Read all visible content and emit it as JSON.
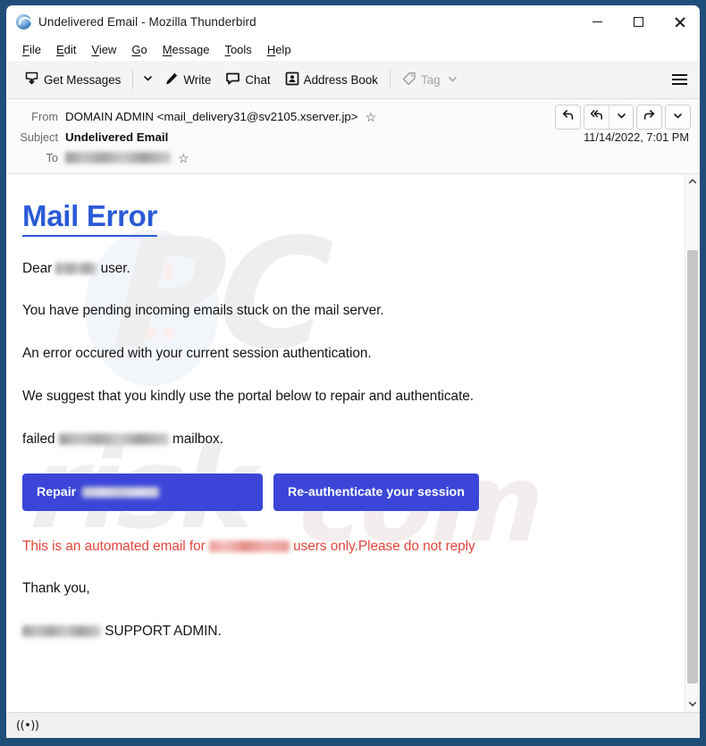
{
  "window": {
    "title": "Undelivered Email - Mozilla Thunderbird",
    "app_icon": "thunderbird-icon",
    "border_color": "#1f4e79",
    "controls": {
      "minimize": "minimize-icon",
      "maximize": "maximize-icon",
      "close": "close-icon"
    }
  },
  "menubar": {
    "items": [
      {
        "label": "File",
        "accesskey": "F"
      },
      {
        "label": "Edit",
        "accesskey": "E"
      },
      {
        "label": "View",
        "accesskey": "V"
      },
      {
        "label": "Go",
        "accesskey": "G"
      },
      {
        "label": "Message",
        "accesskey": "M"
      },
      {
        "label": "Tools",
        "accesskey": "T"
      },
      {
        "label": "Help",
        "accesskey": "H"
      }
    ]
  },
  "toolbar": {
    "get_messages": "Get Messages",
    "get_messages_icon": "inbox-download-icon",
    "get_messages_caret": "chevron-down-icon",
    "write": "Write",
    "write_icon": "pencil-icon",
    "chat": "Chat",
    "chat_icon": "speech-bubble-icon",
    "address_book": "Address Book",
    "address_book_icon": "contact-card-icon",
    "tag": "Tag",
    "tag_icon": "tag-icon",
    "tag_caret": "chevron-down-icon",
    "tag_disabled": true,
    "app_menu_icon": "hamburger-menu-icon"
  },
  "message_header": {
    "from_label": "From",
    "from_value": "DOMAIN ADMIN <mail_delivery31@sv2105.xserver.jp>",
    "from_star": "star-icon",
    "subject_label": "Subject",
    "subject_value": "Undelivered Email",
    "to_label": "To",
    "to_value_redacted": true,
    "to_star": "star-icon",
    "date": "11/14/2022, 7:01 PM",
    "actions": {
      "reply": "reply-icon",
      "reply_all": "reply-all-icon",
      "reply_all_caret": "chevron-down-icon",
      "forward": "forward-icon",
      "more_caret": "chevron-down-icon"
    }
  },
  "email_body": {
    "heading": "Mail Error",
    "heading_color": "#2a5bd7",
    "greeting_before": "Dear",
    "greeting_after": "user.",
    "line_pending": "You have pending incoming emails stuck on the mail server.",
    "line_error": "An error occured with your current session authentication.",
    "line_suggest": "We suggest that you kindly use the portal below to repair and authenticate.",
    "line_failed_before": "failed",
    "line_failed_after": "mailbox.",
    "button_repair_label": "Repair",
    "button_reauth_label": "Re-authenticate your session",
    "button_color": "#3b46d8",
    "notice_before": "This is an automated email for",
    "notice_after": "users only.Please do not reply",
    "notice_color": "#e0453c",
    "thanks": "Thank you,",
    "signature_after": "SUPPORT ADMIN.",
    "watermark": {
      "part1": "PC",
      "part2": "risk",
      "part3": "com"
    }
  },
  "scrollbar": {
    "up_icon": "chevron-up-icon",
    "down_icon": "chevron-down-icon",
    "thumb": "scroll-thumb"
  },
  "statusbar": {
    "connection_icon": "((•))"
  }
}
